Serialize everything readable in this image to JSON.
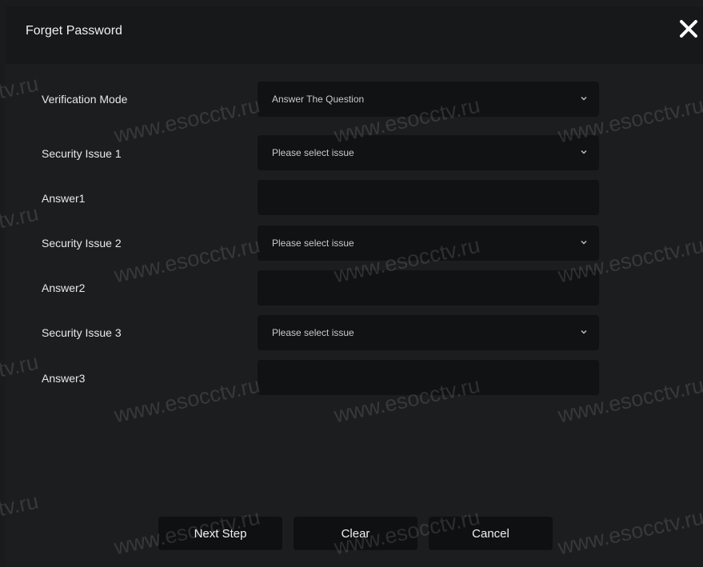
{
  "dialog": {
    "title": "Forget Password",
    "close_icon": "close-icon"
  },
  "form": {
    "verification_mode": {
      "label": "Verification Mode",
      "value": "Answer The Question"
    },
    "security_issue_1": {
      "label": "Security Issue 1",
      "value": "Please select issue"
    },
    "answer_1": {
      "label": "Answer1",
      "value": ""
    },
    "security_issue_2": {
      "label": "Security Issue 2",
      "value": "Please select issue"
    },
    "answer_2": {
      "label": "Answer2",
      "value": ""
    },
    "security_issue_3": {
      "label": "Security Issue 3",
      "value": "Please select issue"
    },
    "answer_3": {
      "label": "Answer3",
      "value": ""
    }
  },
  "buttons": {
    "next_step": "Next Step",
    "clear": "Clear",
    "cancel": "Cancel"
  },
  "watermark": {
    "text": "www.esocctv.ru",
    "partial": "tv.ru"
  },
  "colors": {
    "background": "#1c1d1f",
    "titlebar": "#17181a",
    "field": "#111214",
    "button": "#0f1012",
    "text": "#e8e8e8"
  }
}
